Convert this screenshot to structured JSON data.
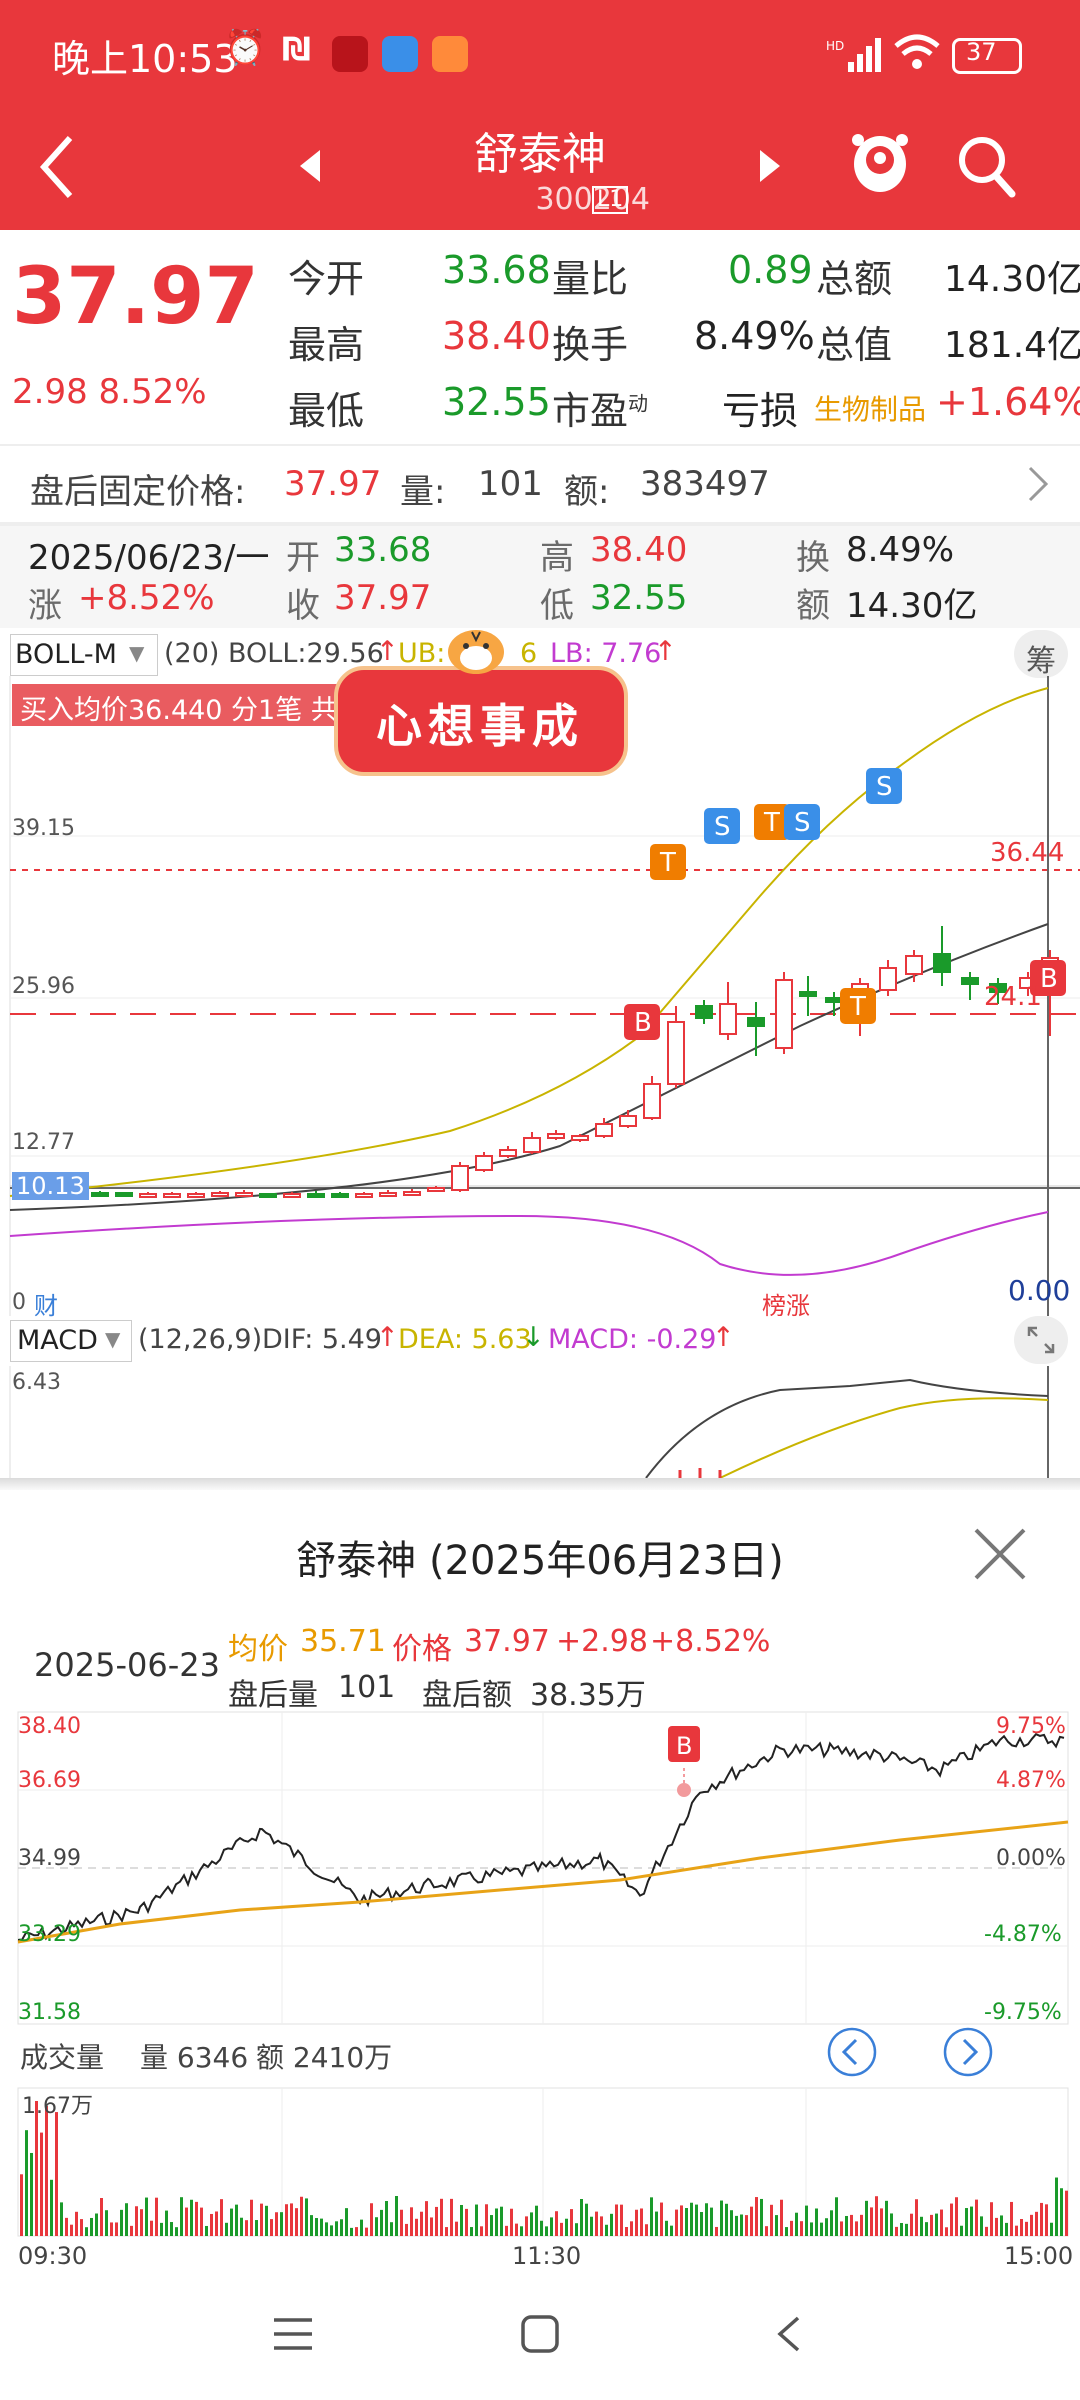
{
  "status_bar": {
    "time": "晚上10:53",
    "battery": "37"
  },
  "header": {
    "title": "舒泰神",
    "code": "300204",
    "level": "L1"
  },
  "quote": {
    "price": "37.97",
    "change": "2.98",
    "change_pct": "8.52%",
    "fields": [
      {
        "label": "今开",
        "value": "33.68",
        "color": "green"
      },
      {
        "label": "量比",
        "value": "0.89",
        "color": "green"
      },
      {
        "label": "总额",
        "value": "14.30亿",
        "color": "black"
      },
      {
        "label": "最高",
        "value": "38.40",
        "color": "red"
      },
      {
        "label": "换手",
        "value": "8.49%",
        "color": "black"
      },
      {
        "label": "总值",
        "value": "181.4亿",
        "color": "black"
      },
      {
        "label": "最低",
        "value": "32.55",
        "color": "green"
      },
      {
        "label": "市盈",
        "value": "亏损",
        "color": "black",
        "sup": "动"
      }
    ],
    "sector_name": "生物制品",
    "sector_change": "+1.64%"
  },
  "after_hours": {
    "label": "盘后固定价格:",
    "price": "37.97",
    "vol_label": "量:",
    "vol": "101",
    "amt_label": "额:",
    "amt": "383497"
  },
  "day_info": {
    "date": "2025/06/23/一",
    "open_label": "开",
    "open": "33.68",
    "high_label": "高",
    "high": "38.40",
    "turnover_label": "换",
    "turnover": "8.49%",
    "change_label": "涨",
    "change": "+8.52%",
    "close_label": "收",
    "close": "37.97",
    "low_label": "低",
    "low": "32.55",
    "amount_label": "额",
    "amount": "14.30亿"
  },
  "boll": {
    "indicator": "BOLL-M",
    "params": "(20) BOLL:29.56",
    "ub_label": "UB:",
    "ub_fragment": "6",
    "lb_label": "LB: 7.76",
    "buy_avg": "买入均价36.440 分1笔 共",
    "sticker": "心想事成",
    "chip_button": "筹",
    "y_labels": [
      "39.15",
      "25.96",
      "12.77",
      "10.13",
      "0"
    ],
    "right_labels": [
      "36.44",
      "24.1",
      "0.00"
    ],
    "tags": [
      "财",
      "榜涨"
    ]
  },
  "macd": {
    "indicator": "MACD",
    "params": "(12,26,9)",
    "dif": "DIF: 5.49",
    "dea": "DEA: 5.63",
    "macd": "MACD: -0.29",
    "top_label": "6.43"
  },
  "intraday": {
    "title": "舒泰神 (2025年06月23日)",
    "date": "2025-06-23",
    "avg_label": "均价",
    "avg": "35.71",
    "price_label": "价格",
    "price": "37.97",
    "change": "+2.98",
    "change_pct": "+8.52%",
    "ah_vol_label": "盘后量",
    "ah_vol": "101",
    "ah_amt_label": "盘后额",
    "ah_amt": "38.35万",
    "left_axis": [
      "38.40",
      "36.69",
      "34.99",
      "33.29",
      "31.58"
    ],
    "right_axis": [
      "9.75%",
      "4.87%",
      "0.00%",
      "-4.87%",
      "-9.75%"
    ],
    "volume_label": "成交量",
    "volume_value": "量 6346",
    "amount_value": "额 2410万",
    "vol_max": "1.67万",
    "time_axis": [
      "09:30",
      "11:30",
      "15:00"
    ]
  },
  "colors": {
    "brand_red": "#e8373c",
    "up": "#e8373c",
    "down": "#1a9a2a",
    "mid": "#c8b400",
    "lower": "#444444",
    "macd_pink": "#c23bd0",
    "avg_line": "#e8a317"
  }
}
